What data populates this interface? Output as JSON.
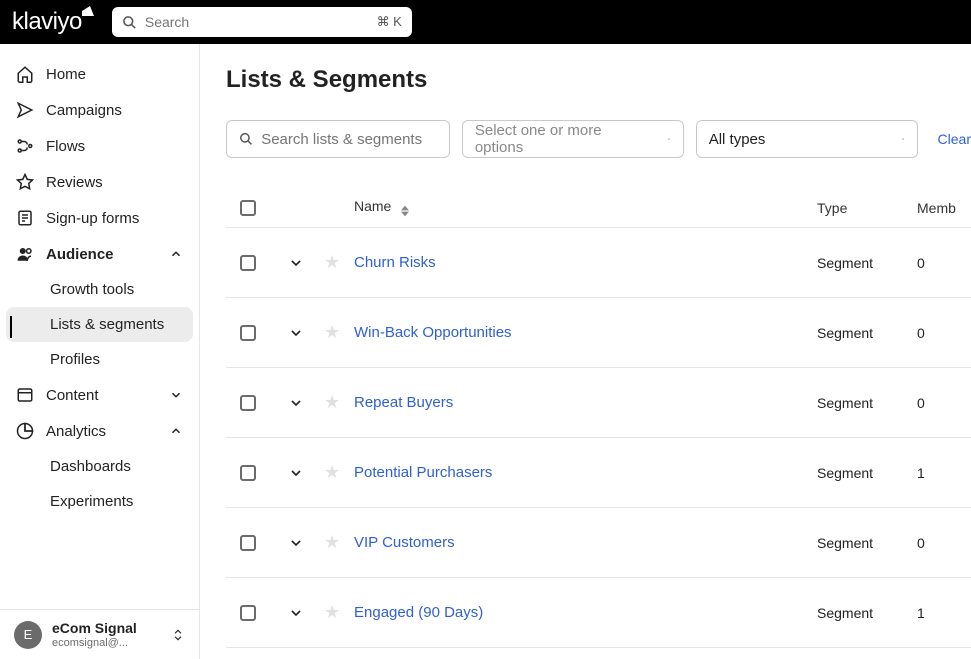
{
  "topbar": {
    "search_placeholder": "Search",
    "search_kbd": "⌘ K"
  },
  "sidebar": {
    "items": [
      {
        "label": "Home"
      },
      {
        "label": "Campaigns"
      },
      {
        "label": "Flows"
      },
      {
        "label": "Reviews"
      },
      {
        "label": "Sign-up forms"
      },
      {
        "label": "Audience"
      },
      {
        "label": "Content"
      },
      {
        "label": "Analytics"
      }
    ],
    "audience_children": [
      {
        "label": "Growth tools"
      },
      {
        "label": "Lists & segments"
      },
      {
        "label": "Profiles"
      }
    ],
    "analytics_children": [
      {
        "label": "Dashboards"
      },
      {
        "label": "Experiments"
      }
    ]
  },
  "account": {
    "initial": "E",
    "name": "eCom Signal",
    "email": "ecomsignal@..."
  },
  "page": {
    "title": "Lists & Segments",
    "search_placeholder": "Search lists & segments",
    "tags_placeholder": "Select one or more options",
    "type_filter": "All types",
    "clear": "Clear"
  },
  "table": {
    "headers": {
      "name": "Name",
      "type": "Type",
      "members": "Memb"
    },
    "rows": [
      {
        "name": "Churn Risks",
        "type": "Segment",
        "members": "0"
      },
      {
        "name": "Win-Back Opportunities",
        "type": "Segment",
        "members": "0"
      },
      {
        "name": "Repeat Buyers",
        "type": "Segment",
        "members": "0"
      },
      {
        "name": "Potential Purchasers",
        "type": "Segment",
        "members": "1"
      },
      {
        "name": "VIP Customers",
        "type": "Segment",
        "members": "0"
      },
      {
        "name": "Engaged (90 Days)",
        "type": "Segment",
        "members": "1"
      }
    ]
  }
}
